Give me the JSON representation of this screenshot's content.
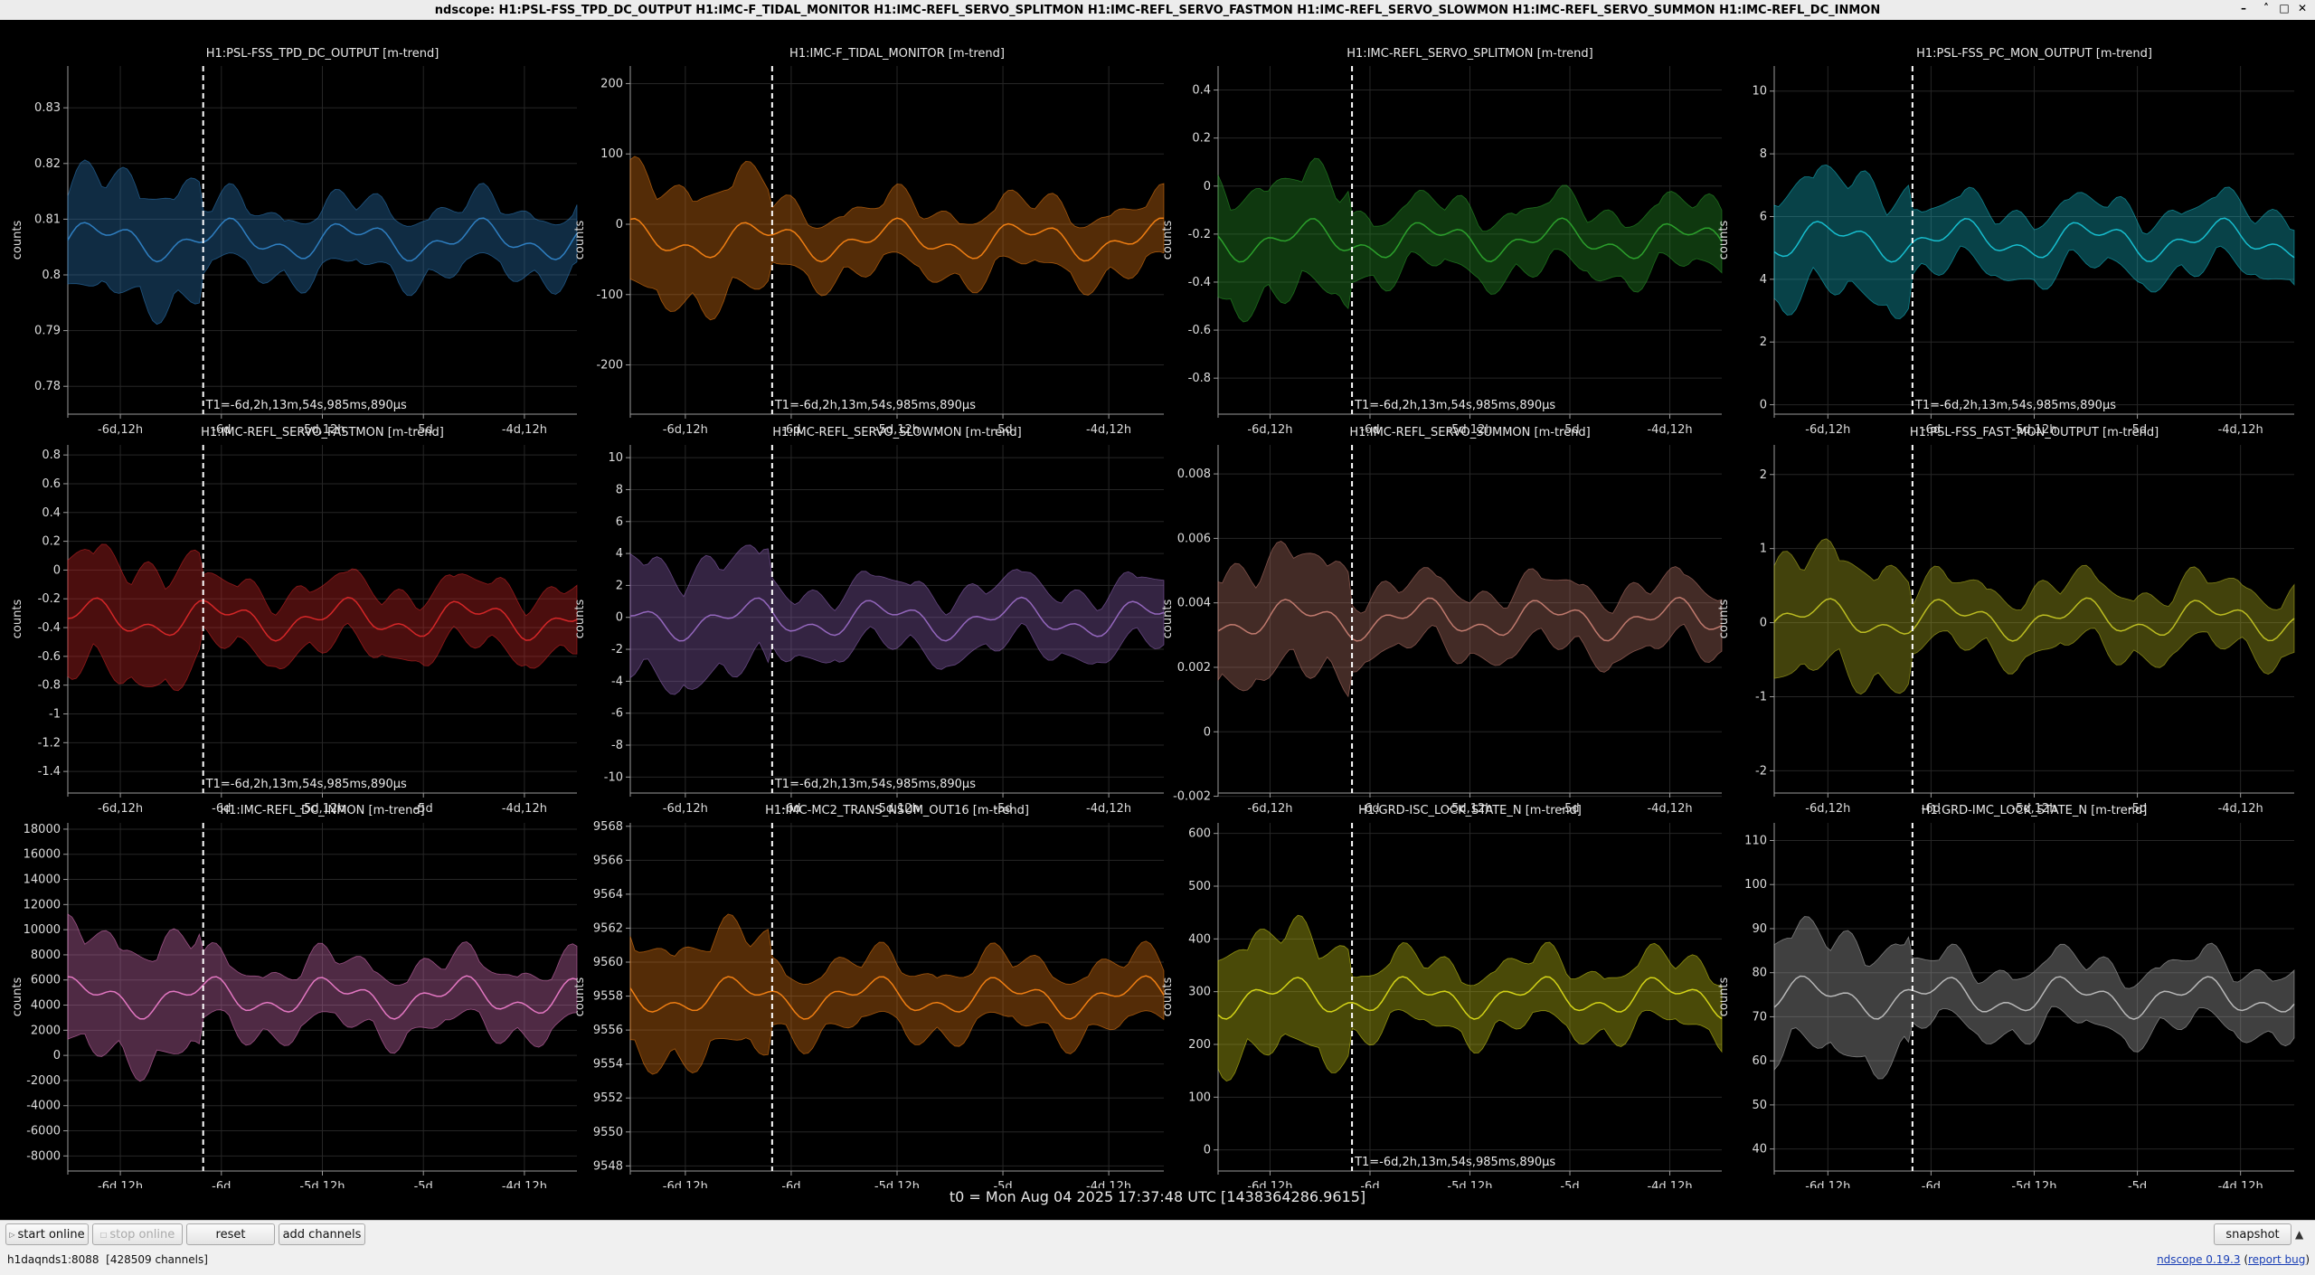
{
  "window": {
    "title": "ndscope: H1:PSL-FSS_TPD_DC_OUTPUT H1:IMC-F_TIDAL_MONITOR H1:IMC-REFL_SERVO_SPLITMON H1:IMC-REFL_SERVO_FASTMON H1:IMC-REFL_SERVO_SLOWMON H1:IMC-REFL_SERVO_SUMMON H1:IMC-REFL_DC_INMON",
    "controls": [
      "–",
      "˄",
      "□",
      "✕"
    ]
  },
  "cursor_label": "T1=-6d,2h,13m,54s,985ms,890μs",
  "y_axis_label": "counts",
  "x_ticks": [
    "-6d,12h",
    "-6d",
    "-5d,12h",
    "-5d",
    "-4d,12h"
  ],
  "x_tick_values": [
    -6.5,
    -6.0,
    -5.5,
    -5.0,
    -4.5
  ],
  "x_range": [
    -6.76,
    -4.24
  ],
  "cursor_t": -6.09,
  "t0_label": "t0 = Mon Aug 04 2025 17:37:48 UTC [1438364286.9615]",
  "plots": [
    {
      "title": "H1:PSL-FSS_TPD_DC_OUTPUT [m-trend]",
      "color": "#2f7fc1",
      "y_ticks": [
        "0.83",
        "0.82",
        "0.81",
        "0.8",
        "0.79",
        "0.78"
      ],
      "y_tick_values": [
        0.83,
        0.82,
        0.81,
        0.8,
        0.79,
        0.78
      ],
      "y_range": [
        0.775,
        0.8375
      ],
      "show_cursor_label": true
    },
    {
      "title": "H1:IMC-F_TIDAL_MONITOR [m-trend]",
      "color": "#f07f13",
      "y_ticks": [
        "200",
        "100",
        "0",
        "-100",
        "-200"
      ],
      "y_tick_values": [
        200,
        100,
        0,
        -100,
        -200
      ],
      "y_range": [
        -270,
        225
      ],
      "show_cursor_label": true
    },
    {
      "title": "H1:IMC-REFL_SERVO_SPLITMON [m-trend]",
      "color": "#2ca02c",
      "y_ticks": [
        "0.4",
        "0.2",
        "0",
        "-0.2",
        "-0.4",
        "-0.6",
        "-0.8"
      ],
      "y_tick_values": [
        0.4,
        0.2,
        0,
        -0.2,
        -0.4,
        -0.6,
        -0.8
      ],
      "y_range": [
        -0.95,
        0.5
      ],
      "show_cursor_label": true
    },
    {
      "title": "H1:PSL-FSS_PC_MON_OUTPUT [m-trend]",
      "color": "#17becf",
      "y_ticks": [
        "10",
        "8",
        "6",
        "4",
        "2",
        "0"
      ],
      "y_tick_values": [
        10,
        8,
        6,
        4,
        2,
        0
      ],
      "y_range": [
        -0.3,
        10.8
      ],
      "show_cursor_label": true
    },
    {
      "title": "H1:IMC-REFL_SERVO_FASTMON [m-trend]",
      "color": "#d62728",
      "y_ticks": [
        "0.8",
        "0.6",
        "0.4",
        "0.2",
        "0",
        "-0.2",
        "-0.4",
        "-0.6",
        "-0.8",
        "-1",
        "-1.2",
        "-1.4"
      ],
      "y_tick_values": [
        0.8,
        0.6,
        0.4,
        0.2,
        0,
        -0.2,
        -0.4,
        -0.6,
        -0.8,
        -1,
        -1.2,
        -1.4
      ],
      "y_range": [
        -1.55,
        0.87
      ],
      "show_cursor_label": true
    },
    {
      "title": "H1:IMC-REFL_SERVO_SLOWMON [m-trend]",
      "color": "#9467bd",
      "y_ticks": [
        "10",
        "8",
        "6",
        "4",
        "2",
        "0",
        "-2",
        "-4",
        "-6",
        "-8",
        "-10"
      ],
      "y_tick_values": [
        10,
        8,
        6,
        4,
        2,
        0,
        -2,
        -4,
        -6,
        -8,
        -10
      ],
      "y_range": [
        -11,
        10.8
      ],
      "show_cursor_label": true
    },
    {
      "title": "H1:IMC-REFL_SERVO_SUMMON [m-trend]",
      "color": "#c07a6e",
      "y_ticks": [
        "0.008",
        "0.006",
        "0.004",
        "0.002",
        "0",
        "-0.002"
      ],
      "y_tick_values": [
        0.008,
        0.006,
        0.004,
        0.002,
        0,
        -0.002
      ],
      "y_range": [
        -0.0019,
        0.0089
      ],
      "show_cursor_label": false
    },
    {
      "title": "H1:PSL-FSS_FAST_MON_OUTPUT [m-trend]",
      "color": "#bcbd22",
      "y_ticks": [
        "2",
        "1",
        "0",
        "-1",
        "-2"
      ],
      "y_tick_values": [
        2,
        1,
        0,
        -1,
        -2
      ],
      "y_range": [
        -2.3,
        2.4
      ],
      "show_cursor_label": false
    },
    {
      "title": "H1:IMC-REFL_DC_INMON [m-trend]",
      "color": "#e377c2",
      "y_ticks": [
        "18000",
        "16000",
        "14000",
        "12000",
        "10000",
        "8000",
        "6000",
        "4000",
        "2000",
        "0",
        "-2000",
        "-4000",
        "-6000",
        "-8000"
      ],
      "y_tick_values": [
        18000,
        16000,
        14000,
        12000,
        10000,
        8000,
        6000,
        4000,
        2000,
        0,
        -2000,
        -4000,
        -6000,
        -8000
      ],
      "y_range": [
        -9200,
        18500
      ],
      "show_cursor_label": false
    },
    {
      "title": "H1:IMC-MC2_TRANS_NSUM_OUT16 [m-trend]",
      "color": "#f07f13",
      "y_ticks": [
        "9568",
        "9566",
        "9564",
        "9562",
        "9560",
        "9558",
        "9556",
        "9554",
        "9552",
        "9550",
        "9548"
      ],
      "y_tick_values": [
        9568,
        9566,
        9564,
        9562,
        9560,
        9558,
        9556,
        9554,
        9552,
        9550,
        9548
      ],
      "y_range": [
        9547.7,
        9568.2
      ],
      "show_cursor_label": false
    },
    {
      "title": "H1:GRD-ISC_LOCK_STATE_N [m-trend]",
      "color": "#d4d418",
      "y_ticks": [
        "600",
        "500",
        "400",
        "300",
        "200",
        "100",
        "0"
      ],
      "y_tick_values": [
        600,
        500,
        400,
        300,
        200,
        100,
        0
      ],
      "y_range": [
        -40,
        620
      ],
      "show_cursor_label": true
    },
    {
      "title": "H1:GRD-IMC_LOCK_STATE_N [m-trend]",
      "color": "#b8b8b8",
      "y_ticks": [
        "110",
        "100",
        "90",
        "80",
        "70",
        "60",
        "50",
        "40"
      ],
      "y_tick_values": [
        110,
        100,
        90,
        80,
        70,
        60,
        50,
        40
      ],
      "y_range": [
        35,
        114
      ],
      "show_cursor_label": false
    }
  ],
  "buttons": {
    "start_online": "start online",
    "stop_online": "stop online",
    "reset": "reset",
    "add_channels": "add channels",
    "snapshot": "snapshot"
  },
  "status": {
    "server": "h1daqnds1:8088",
    "channels": "[428509 channels]"
  },
  "version": {
    "app_link": "ndscope 0.19.3",
    "report_prefix": "(",
    "report_link": "report bug",
    "report_suffix": ")"
  }
}
